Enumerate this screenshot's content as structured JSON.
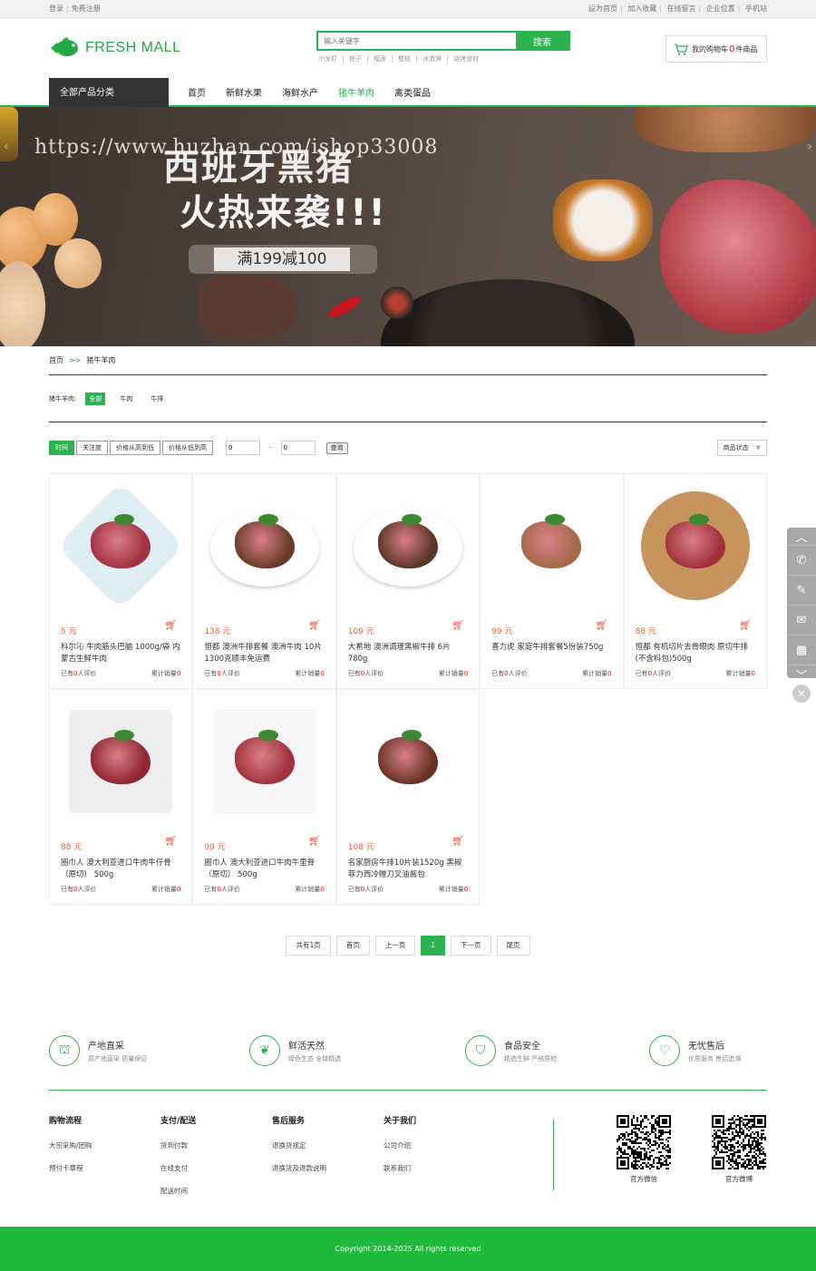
{
  "topbar": {
    "login": "登录",
    "register": "免费注册",
    "links": [
      "设为首页",
      "加入收藏",
      "在线留言",
      "企业位置",
      "手机站"
    ]
  },
  "header": {
    "logo_text": "FRESH MALL",
    "search_placeholder": "输入关键字",
    "search_button": "搜索",
    "hotwords": [
      "小龙虾",
      "粽子",
      "榴莲",
      "樱桃",
      "冰激淋",
      "烧烤食材"
    ],
    "cart_prefix": "我的购物车",
    "cart_count": "0",
    "cart_suffix": "件商品"
  },
  "nav": {
    "all_categories": "全部产品分类",
    "items": [
      "首页",
      "新鲜水果",
      "海鲜水产",
      "猪牛羊肉",
      "禽类蛋品"
    ],
    "active_index": 3
  },
  "banner": {
    "watermark": "https://www.huzhan.com/ishop33008",
    "headline1": "西班牙黑猪",
    "headline2": "火热来袭!!!",
    "promo": "满199减100"
  },
  "breadcrumb": {
    "home": "首页",
    "sep": ">>",
    "current": "猪牛羊肉"
  },
  "filter": {
    "label": "猪牛羊肉:",
    "tags": [
      "全部",
      "牛肉",
      "牛排"
    ]
  },
  "sortbar": {
    "buttons": [
      "时间",
      "关注度",
      "价格从高到低",
      "价格从低到高"
    ],
    "min_value": "0",
    "dash": "-",
    "max_value": "0",
    "query": "查询",
    "state": "商品状态"
  },
  "products": [
    {
      "price": "5 元",
      "name": "科尔沁 牛肉筋头巴脑 1000g/袋 内蒙古生鲜牛肉",
      "reviews": "0",
      "sales": "0"
    },
    {
      "price": "138 元",
      "name": "恒都 澳洲牛排套餐 澳洲牛肉 10片1300克顺丰免运费",
      "reviews": "0",
      "sales": "0"
    },
    {
      "price": "109 元",
      "name": "大希地 澳洲调理黑椒牛排 6片 780g",
      "reviews": "0",
      "sales": "0"
    },
    {
      "price": "99 元",
      "name": "喜力虎 家庭牛排套餐5份装750g",
      "reviews": "0",
      "sales": "0"
    },
    {
      "price": "88 元",
      "name": "恒都 有机切片去骨眼肉 原切牛排(不含料包)500g",
      "reviews": "0",
      "sales": "0"
    },
    {
      "price": "88 元",
      "name": "圈巾人 澳大利亚进口牛肉牛仔骨（原切） 500g",
      "reviews": "0",
      "sales": "0"
    },
    {
      "price": "99 元",
      "name": "圈巾人 澳大利亚进口牛肉牛里脊（原切） 500g",
      "reviews": "0",
      "sales": "0"
    },
    {
      "price": "108 元",
      "name": "名家厨房牛排10片装1520g 黑椒 菲力西冷赠刀叉油酱包",
      "reviews": "0",
      "sales": "0"
    }
  ],
  "product_labels": {
    "reviews_prefix": "已有",
    "reviews_suffix": "人评价",
    "sales_prefix": "累计销量"
  },
  "pager": [
    "共有1页",
    "首页",
    "上一页",
    "1",
    "下一页",
    "尾页"
  ],
  "features": [
    {
      "title": "产地直采",
      "sub": "原产地直采 质量保证"
    },
    {
      "title": "鲜活天然",
      "sub": "绿色生态 全球精选"
    },
    {
      "title": "食品安全",
      "sub": "精选生鲜 严格质检"
    },
    {
      "title": "无忧售后",
      "sub": "优质服务 售后追溯"
    }
  ],
  "footer": {
    "columns": [
      {
        "title": "购物流程",
        "links": [
          "大宗采购/团购",
          "预付卡章程"
        ]
      },
      {
        "title": "支付/配送",
        "links": [
          "货到付款",
          "在线支付",
          "配送时间"
        ]
      },
      {
        "title": "售后服务",
        "links": [
          "退换货规定",
          "退换货及退款说明"
        ]
      },
      {
        "title": "关于我们",
        "links": [
          "公司介绍",
          "联系我们"
        ]
      }
    ],
    "qr": [
      "官方微信",
      "官方微博"
    ],
    "copyright": "Copyright 2014-2025    All rights reserved"
  },
  "colors": {
    "accent": "#2cb24f",
    "price": "#f0643c",
    "footer_bg": "#1fb93e"
  }
}
